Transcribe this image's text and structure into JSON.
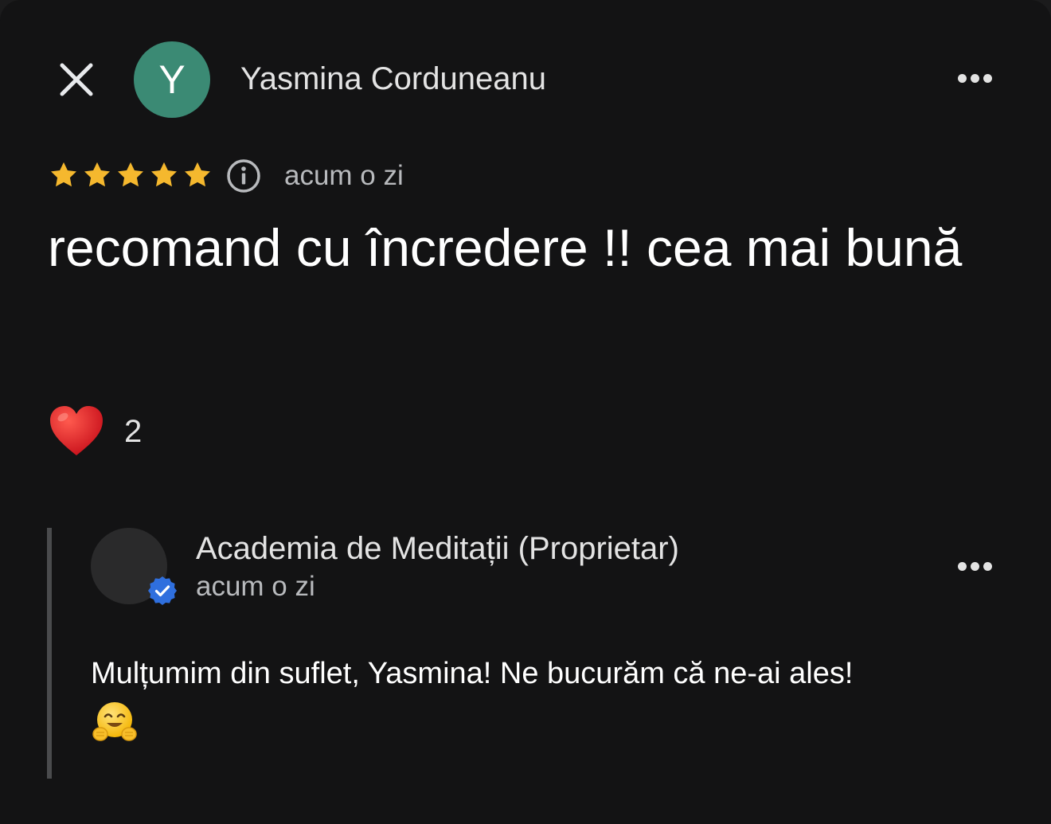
{
  "header": {
    "avatar_initial": "Y",
    "avatar_color": "#3b8a74",
    "reviewer_name": "Yasmina Corduneanu",
    "close_icon": "close-icon",
    "more_icon": "more-horizontal-icon"
  },
  "rating": {
    "stars": 5,
    "max_stars": 5,
    "star_color": "#f5b82e",
    "time": "acum o zi"
  },
  "review": {
    "text": "recomand cu încredere !! cea mai bună"
  },
  "reaction": {
    "icon": "heart-icon",
    "count": "2"
  },
  "reply": {
    "owner_name": "Academia de Meditații (Proprietar)",
    "time": "acum o zi",
    "verified_color": "#2f6fde",
    "text": "Mulțumim din suflet, Yasmina! Ne bucurăm că ne-ai ales!",
    "emoji": "hugging-face-emoji"
  }
}
